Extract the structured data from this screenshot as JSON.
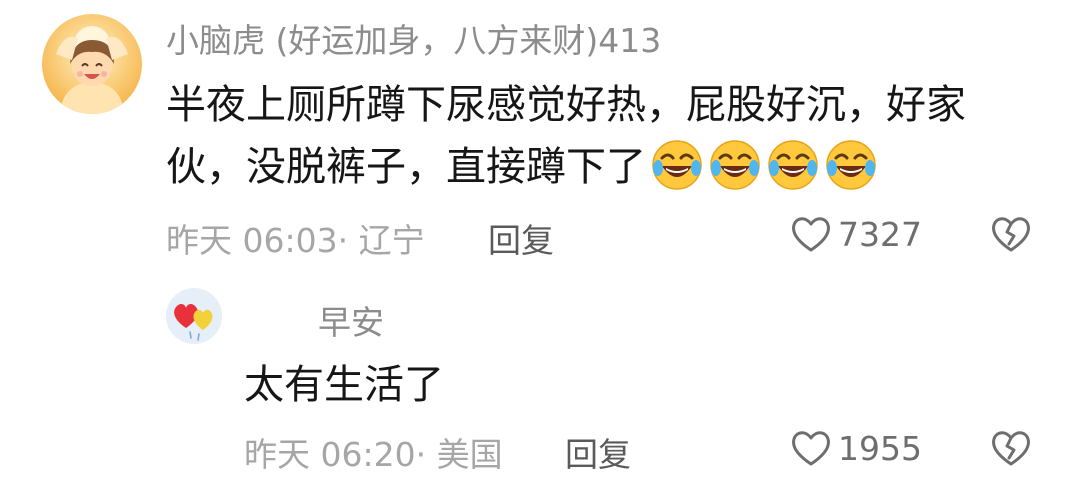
{
  "comments": [
    {
      "username": "小脑虎 (好运加身，八方来财)413",
      "content": "半夜上厕所蹲下尿感觉好热，屁股好沉，好家伙，没脱裤子，直接蹲下了",
      "emoji_icons": [
        "rofl-emoji-icon",
        "rofl-emoji-icon",
        "rofl-emoji-icon",
        "rofl-emoji-icon"
      ],
      "meta": "昨天 06:03· 辽宁",
      "reply_label": "回复",
      "like_count": "7327",
      "like_icon": "heart-outline-icon",
      "dislike_icon": "broken-heart-icon"
    }
  ],
  "replies": [
    {
      "username": "早安",
      "content": "太有生活了",
      "meta": "昨天 06:20· 美国",
      "reply_label": "回复",
      "like_count": "1955",
      "like_icon": "heart-outline-icon",
      "dislike_icon": "broken-heart-icon"
    }
  ],
  "colors": {
    "username": "#8c8c8c",
    "content": "#161616",
    "meta": "#a6a6a6",
    "reply": "#5a5a5a",
    "icon": "#6e6e6e",
    "emoji": "#ffc83d"
  }
}
